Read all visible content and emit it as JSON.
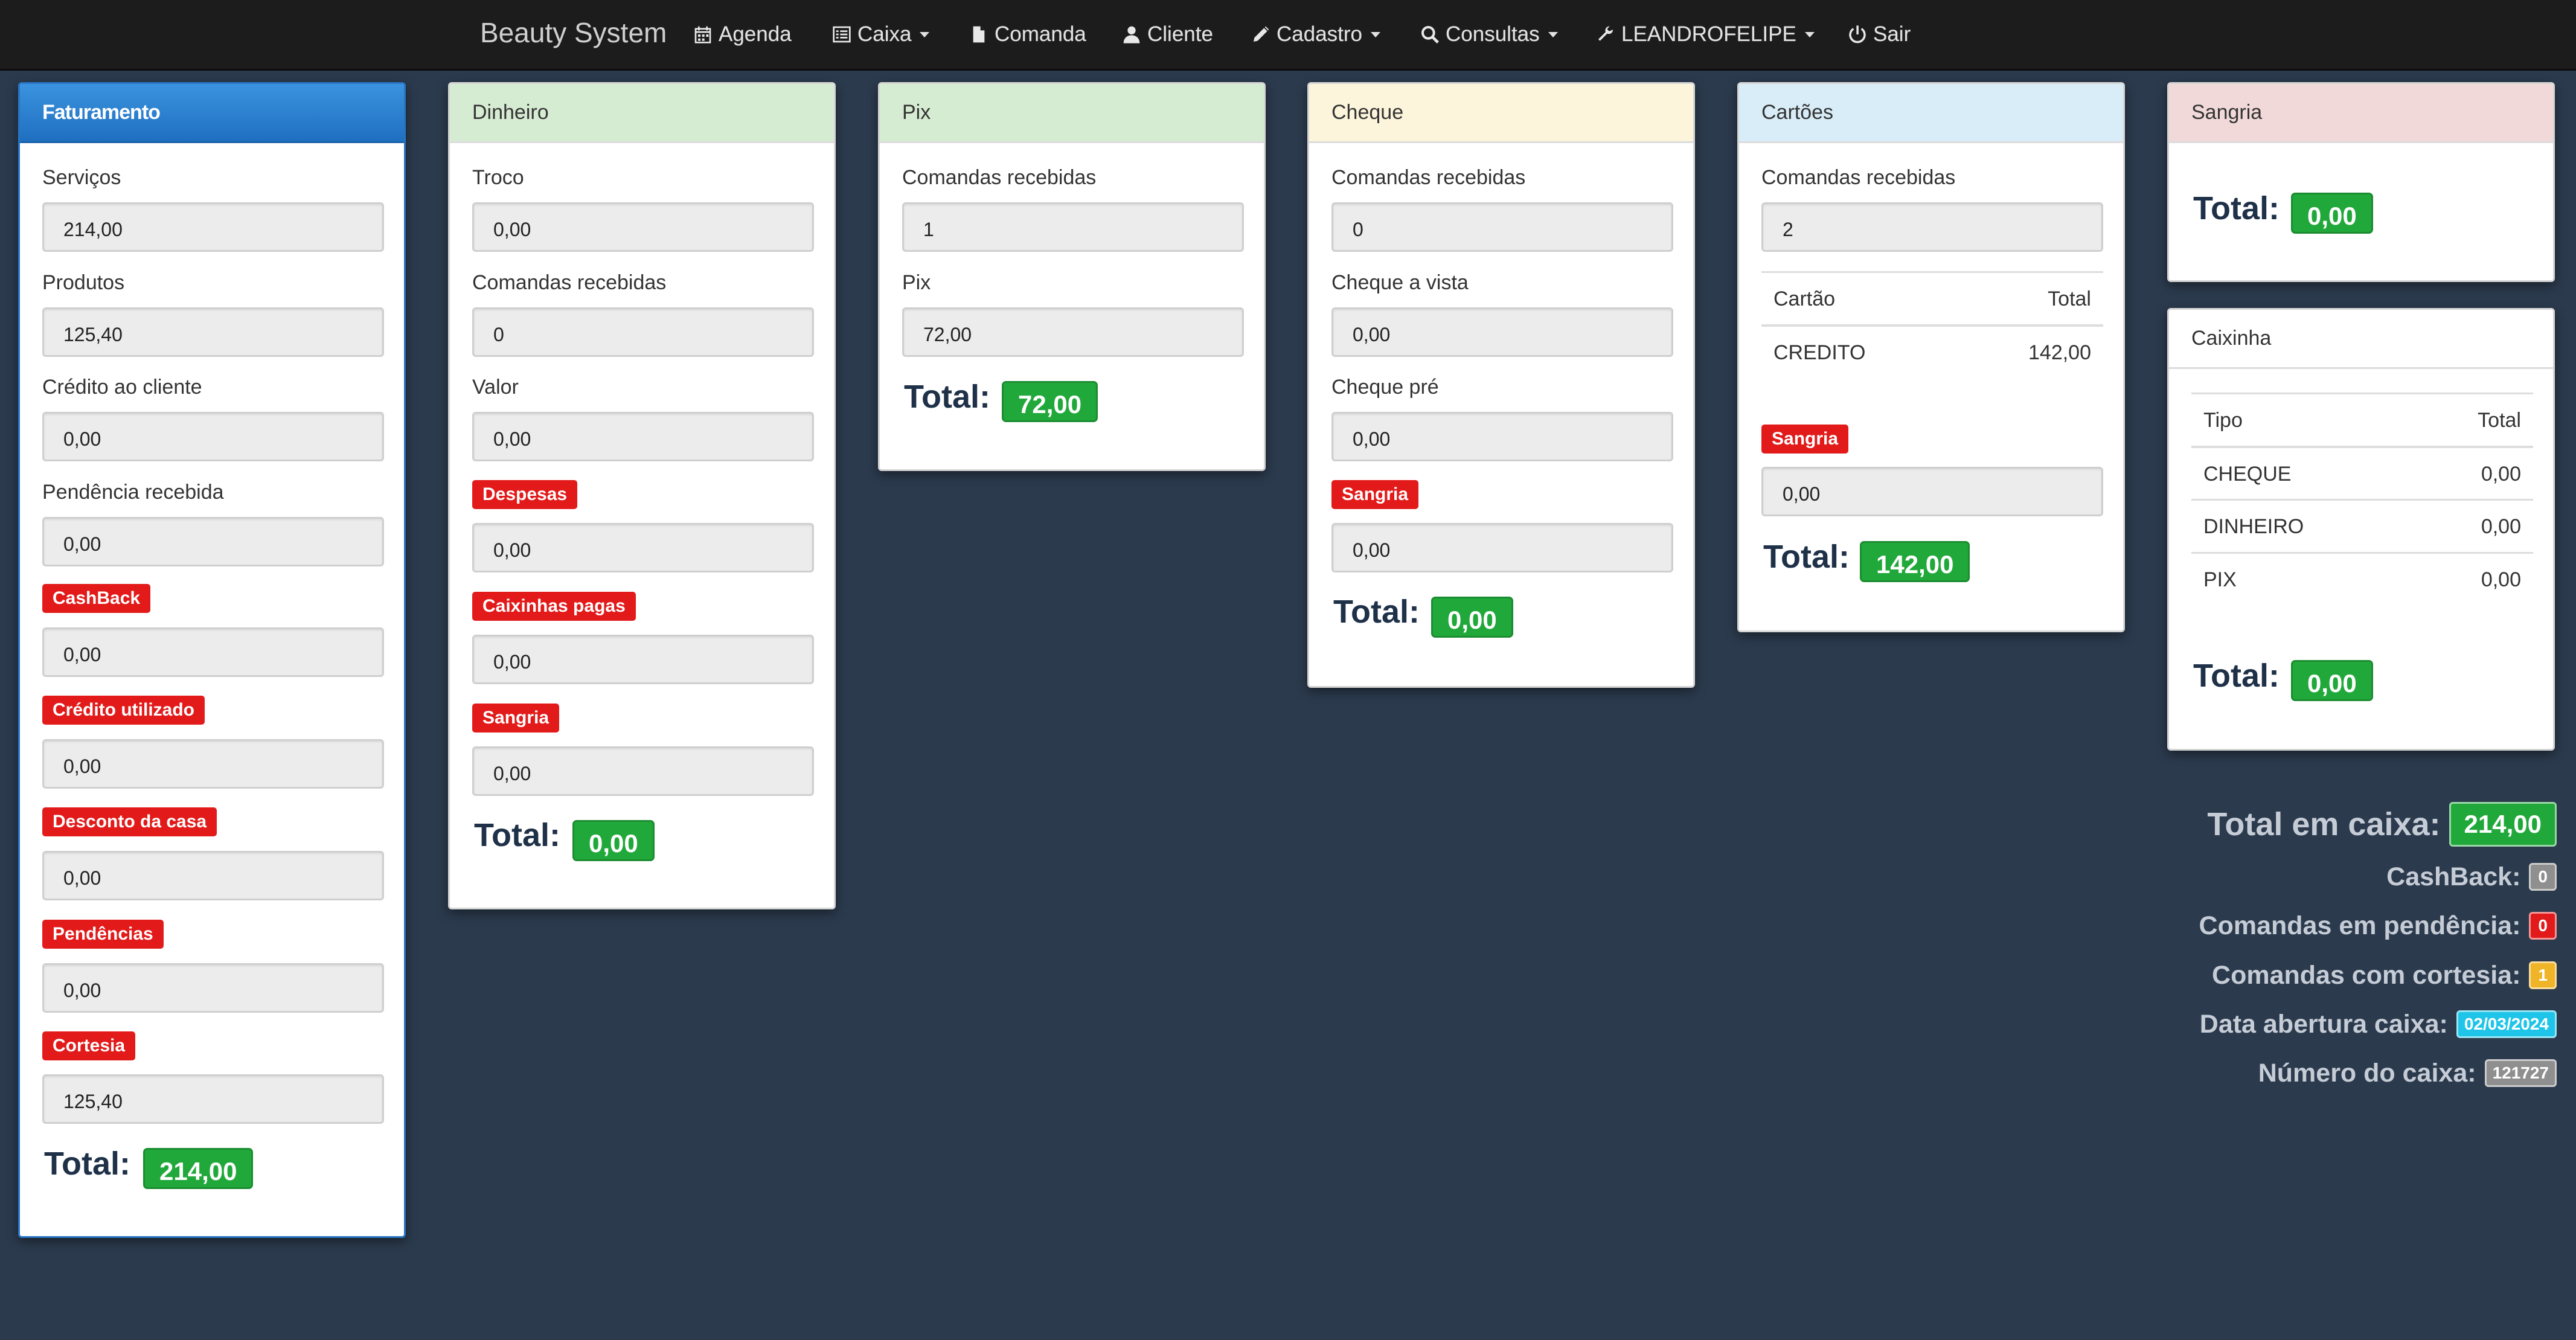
{
  "navbar": {
    "brand": "Beauty System",
    "items": {
      "agenda": "Agenda",
      "caixa": "Caixa",
      "comanda": "Comanda",
      "cliente": "Cliente",
      "cadastro": "Cadastro",
      "consultas": "Consultas",
      "user": "LEANDROFELIPE",
      "sair": "Sair"
    }
  },
  "faturamento": {
    "title": "Faturamento",
    "servicos_label": "Serviços",
    "servicos": "214,00",
    "produtos_label": "Produtos",
    "produtos": "125,40",
    "credito_cliente_label": "Crédito ao cliente",
    "credito_cliente": "0,00",
    "pendencia_label": "Pendência recebida",
    "pendencia": "0,00",
    "cashback_label": "CashBack",
    "cashback": "0,00",
    "credito_utilizado_label": "Crédito utilizado",
    "credito_utilizado": "0,00",
    "desconto_label": "Desconto da casa",
    "desconto": "0,00",
    "pendencias_label": "Pendências",
    "pendencias": "0,00",
    "cortesia_label": "Cortesia",
    "cortesia": "125,40",
    "total_label": "Total:",
    "total": "214,00"
  },
  "dinheiro": {
    "title": "Dinheiro",
    "troco_label": "Troco",
    "troco": "0,00",
    "comandas_label": "Comandas recebidas",
    "comandas": "0",
    "valor_label": "Valor",
    "valor": "0,00",
    "despesas_label": "Despesas",
    "despesas": "0,00",
    "caixinhas_label": "Caixinhas pagas",
    "caixinhas": "0,00",
    "sangria_label": "Sangria",
    "sangria": "0,00",
    "total_label": "Total:",
    "total": "0,00"
  },
  "pix": {
    "title": "Pix",
    "comandas_label": "Comandas recebidas",
    "comandas": "1",
    "pix_label": "Pix",
    "pix": "72,00",
    "total_label": "Total:",
    "total": "72,00"
  },
  "cheque": {
    "title": "Cheque",
    "comandas_label": "Comandas recebidas",
    "comandas": "0",
    "vista_label": "Cheque a vista",
    "vista": "0,00",
    "pre_label": "Cheque pré",
    "pre": "0,00",
    "sangria_label": "Sangria",
    "sangria": "0,00",
    "total_label": "Total:",
    "total": "0,00"
  },
  "cartoes": {
    "title": "Cartões",
    "comandas_label": "Comandas recebidas",
    "comandas": "2",
    "col_cartao": "Cartão",
    "col_total": "Total",
    "rows": [
      {
        "cartao": "CREDITO",
        "total": "142,00"
      }
    ],
    "sangria_label": "Sangria",
    "sangria": "0,00",
    "total_label": "Total:",
    "total": "142,00"
  },
  "sangria": {
    "title": "Sangria",
    "total_label": "Total:",
    "total": "0,00"
  },
  "caixinha": {
    "title": "Caixinha",
    "col_tipo": "Tipo",
    "col_total": "Total",
    "rows": [
      {
        "tipo": "CHEQUE",
        "total": "0,00"
      },
      {
        "tipo": "DINHEIRO",
        "total": "0,00"
      },
      {
        "tipo": "PIX",
        "total": "0,00"
      }
    ],
    "total_label": "Total:",
    "total": "0,00"
  },
  "summary": {
    "total_caixa_label": "Total em caixa:",
    "total_caixa": "214,00",
    "cashback_label": "CashBack:",
    "cashback": "0",
    "pendencia_label": "Comandas em pendência:",
    "pendencia": "0",
    "cortesia_label": "Comandas com cortesia:",
    "cortesia": "1",
    "data_label": "Data abertura caixa:",
    "data": "02/03/2024",
    "numero_label": "Número do caixa:",
    "numero": "121727"
  },
  "colors": {
    "background": "#2b3a4d",
    "navbar": "#1c1c1c",
    "success": "#21a83a",
    "danger": "#e21a1a",
    "warning": "#f0b429",
    "info": "#1ec5e8",
    "muted": "#8f8f8f"
  },
  "icons": {
    "agenda": "calendar-icon",
    "caixa": "list-icon",
    "comanda": "file-icon",
    "cliente": "user-icon",
    "cadastro": "pencil-icon",
    "consultas": "search-icon",
    "user": "wrench-icon",
    "sair": "power-icon"
  }
}
